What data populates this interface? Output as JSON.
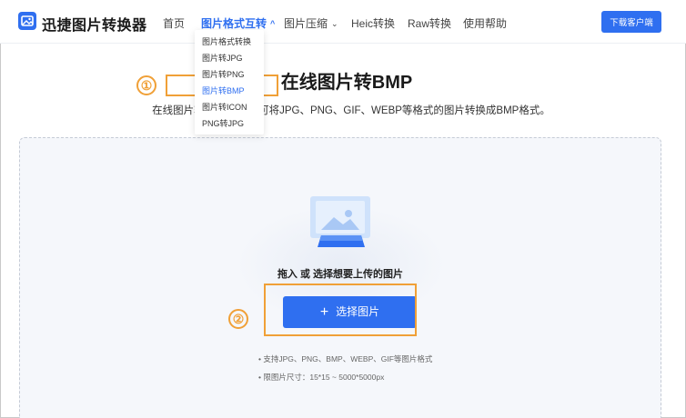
{
  "header": {
    "brand": "迅捷图片转换器",
    "nav": [
      {
        "label": "首页"
      },
      {
        "label": "图片格式互转",
        "chevron": "^",
        "active": true
      },
      {
        "label": "图片压缩",
        "chevron": "⌄"
      },
      {
        "label": "Heic转换"
      },
      {
        "label": "Raw转换"
      },
      {
        "label": "使用帮助"
      }
    ],
    "download_label": "下载客户端"
  },
  "dropdown": {
    "items": [
      {
        "label": "图片格式转换"
      },
      {
        "label": "图片转JPG"
      },
      {
        "label": "图片转PNG"
      },
      {
        "label": "图片转BMP",
        "selected": true
      },
      {
        "label": "图片转ICON"
      },
      {
        "label": "PNG转JPG"
      }
    ]
  },
  "main": {
    "title": "在线图片转BMP",
    "subtitle": "在线图片转BMP工具，可将JPG、PNG、GIF、WEBP等格式的图片转换成BMP格式。"
  },
  "upload": {
    "drop_text": "拖入 或 选择想要上传的图片",
    "select_label": "选择图片",
    "select_icon": "+",
    "notes": [
      "• 支持JPG、PNG、BMP、WEBP、GIF等图片格式",
      "• 限图片尺寸：15*15 ~ 5000*5000px"
    ]
  },
  "annotations": {
    "step1": "①",
    "step2": "②",
    "color": "#f0a037"
  },
  "colors": {
    "accent": "#2f6ff0",
    "upload_bg": "#f5f7fb"
  }
}
